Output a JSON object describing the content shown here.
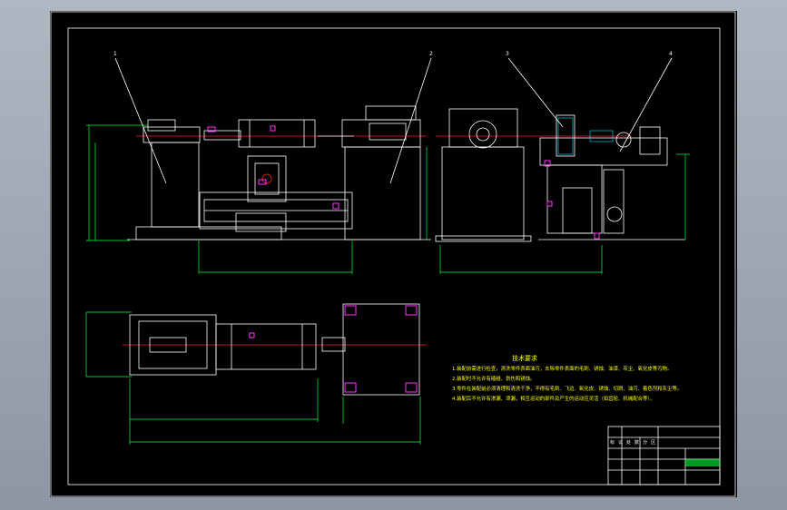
{
  "drawing": {
    "background_color": "#000000",
    "frame_color": "#ffffff",
    "dimension_color": "#00ff3c",
    "centerline_color": "#ff2020",
    "note_color": "#ffff00"
  },
  "notes": {
    "title": "技术要求",
    "lines": [
      "1.装配前需进行检查，清洗零件表面油污，去除零件表面的毛刺、锈蚀、油漆、灰尘、氧化皮等污物。",
      "2.装配时不允许有磕碰、划伤和锈蚀。",
      "3.零件在装配前必须清理和清洗干净，不得有毛刺、飞边、氧化皮、锈蚀、切屑、油污、着色剂和灰尘等。",
      "4.装配后不允许有渗漏、泄漏，相互运动的部件及产生的运动应灵活（如齿轮、机械配合等）。"
    ]
  },
  "title_block": {
    "row_labels": [
      "标",
      "记",
      "处",
      "数",
      "分",
      "区"
    ]
  },
  "callouts": [
    "1",
    "2",
    "3",
    "4"
  ]
}
